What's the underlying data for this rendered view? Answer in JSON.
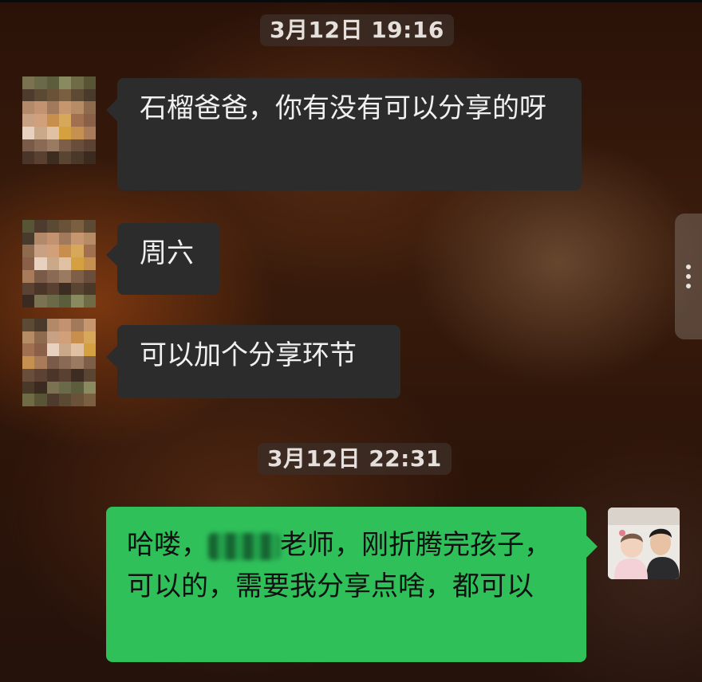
{
  "timestamps": [
    "3月12日 19:16",
    "3月12日 22:31"
  ],
  "messages": [
    {
      "from": "other",
      "text": "石榴爸爸，你有没有可以分享的呀"
    },
    {
      "from": "other",
      "text": "周六"
    },
    {
      "from": "other",
      "text": "可以加个分享环节"
    },
    {
      "from": "self",
      "text_before": "哈喽，",
      "text_after": "老师，刚折腾完孩子，可以的，需要我分享点啥，都可以"
    }
  ],
  "colors": {
    "incoming_bubble": "#2c2c2c",
    "outgoing_bubble": "#2fc05a",
    "timestamp_chip": "#3c2d26"
  },
  "icons": {
    "side_handle": "more-dots-icon",
    "contact_avatar": "pixelated-avatar",
    "self_avatar": "user-avatar"
  }
}
